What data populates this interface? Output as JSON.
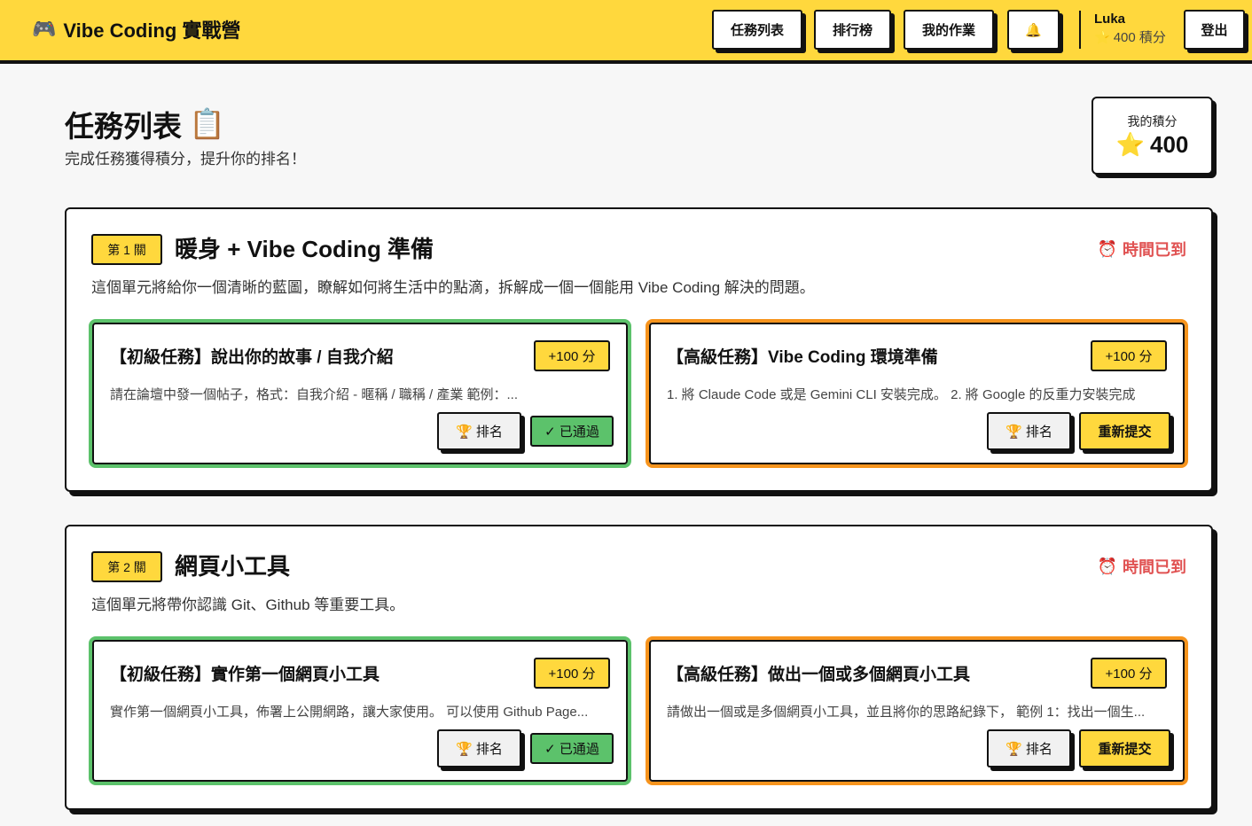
{
  "header": {
    "logo_icon": "🎮",
    "title": "Vibe Coding 實戰營",
    "nav": {
      "tasks": "任務列表",
      "leaderboard": "排行榜",
      "my_work": "我的作業",
      "bell_icon": "🔔"
    },
    "user": {
      "name": "Luka",
      "star_icon": "⭐",
      "points": "400 積分"
    },
    "logout": "登出"
  },
  "page": {
    "title": "任務列表",
    "title_icon": "📋",
    "subtitle": "完成任務獲得積分，提升你的排名！",
    "score": {
      "label": "我的積分",
      "star_icon": "⭐",
      "value": "400"
    }
  },
  "stages": [
    {
      "badge": "第 1 關",
      "title": "暖身 + Vibe Coding 準備",
      "status_icon": "⏰",
      "status": "時間已到",
      "desc": "這個單元將給你一個清晰的藍圖，瞭解如何將生活中的點滴，拆解成一個一個能用 Vibe Coding 解決的問題。",
      "tasks": [
        {
          "title": "【初級任務】說出你的故事 / 自我介紹",
          "points": "+100 分",
          "desc": "請在論壇中發一個帖子，格式：自我介紹 - 暱稱 / 職稱 / 產業 範例：...",
          "rank_icon": "🏆",
          "rank": "排名",
          "action": "✓ 已通過"
        },
        {
          "title": "【高級任務】Vibe Coding 環境準備",
          "points": "+100 分",
          "desc": "1. 將 Claude Code 或是 Gemini CLI 安裝完成。 2. 將 Google 的反重力安裝完成",
          "rank_icon": "🏆",
          "rank": "排名",
          "action": "重新提交"
        }
      ]
    },
    {
      "badge": "第 2 關",
      "title": "網頁小工具",
      "status_icon": "⏰",
      "status": "時間已到",
      "desc": "這個單元將帶你認識 Git、Github 等重要工具。",
      "tasks": [
        {
          "title": "【初級任務】實作第一個網頁小工具",
          "points": "+100 分",
          "desc": "實作第一個網頁小工具，佈署上公開網路，讓大家使用。 可以使用 Github Page...",
          "rank_icon": "🏆",
          "rank": "排名",
          "action": "✓ 已通過"
        },
        {
          "title": "【高級任務】做出一個或多個網頁小工具",
          "points": "+100 分",
          "desc": "請做出一個或是多個網頁小工具，並且將你的思路紀錄下， 範例 1：找出一個生...",
          "rank_icon": "🏆",
          "rank": "排名",
          "action": "重新提交"
        }
      ]
    }
  ]
}
